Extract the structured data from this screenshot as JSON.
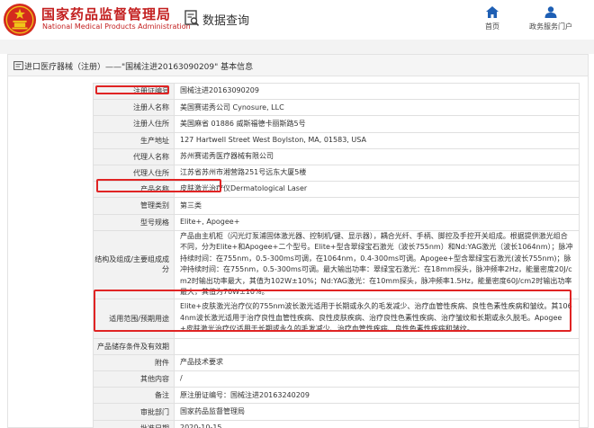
{
  "header": {
    "org_name_cn": "国家药品监督管理局",
    "org_name_en": "National Medical Products Administration",
    "query_label": "数据查询",
    "nav_home_label": "首页",
    "nav_portal_label": "政务服务门户"
  },
  "breadcrumb": {
    "text": "进口医疗器械（注册）——\"国械注进20163090209\" 基本信息"
  },
  "details": [
    {
      "label": "注册证编号",
      "value": "国械注进20163090209"
    },
    {
      "label": "注册人名称",
      "value": "美国赛诺秀公司 Cynosure, LLC"
    },
    {
      "label": "注册人住所",
      "value": "美国麻省 01886 威斯福德卡丽斯路5号"
    },
    {
      "label": "生产地址",
      "value": "127 Hartwell Street West Boylston, MA, 01583, USA"
    },
    {
      "label": "代理人名称",
      "value": "苏州赛诺秀医疗器械有限公司"
    },
    {
      "label": "代理人住所",
      "value": "江苏省苏州市湘营路251号远东大厦5楼"
    },
    {
      "label": "产品名称",
      "value": "皮肤激光治疗仪Dermatological Laser"
    },
    {
      "label": "管理类别",
      "value": "第三类"
    },
    {
      "label": "型号规格",
      "value": "Elite+, Apogee+"
    },
    {
      "label": "结构及组成/主要组成成分",
      "value": "产品由主机柜（闪光灯泵浦固体激光器、控制机/键、显示器），耦合光纤、手柄、脚控及手控开关组成。根据提供激光组合不同，分为Elite+和Apogee+二个型号。Elite+型含翠绿宝石激光（波长755nm）和Nd:YAG激光（波长1064nm）；脉冲持续时间：在755nm，0.5-300ms可调，在1064nm，0.4-300ms可调。Apogee+型含翠绿宝石激光(波长755nm)；脉冲持续时间：在755nm，0.5-300ms可调。最大输出功率：翠绿宝石激光：在18mm探头，脉冲频率2Hz，能量密度20J/cm2时输出功率最大，其值为102W±10%；Nd:YAG激光：在10mm探头，脉冲频率1.5Hz，能量密度60J/cm2时输出功率最大，其值为70W±10%。"
    },
    {
      "label": "适用范围/预期用途",
      "value": "Elite+皮肤激光治疗仪的755nm波长激光适用于长期或永久的毛发减少、治疗血管性疾病、良性色素性疾病和皱纹。其1064nm波长激光适用于治疗良性血管性疾病、良性皮肤疾病、治疗良性色素性疾病、治疗皱纹和长期或永久脱毛。Apogee+皮肤激光治疗仪适用于长期或永久的毛发减少、治疗血管性疾病、良性色素性疾病和皱纹。"
    },
    {
      "label": "产品储存条件及有效期",
      "value": ""
    },
    {
      "label": "附件",
      "value": "产品技术要求"
    },
    {
      "label": "其他内容",
      "value": "/"
    },
    {
      "label": "备注",
      "value": "原注册证编号：国械注进20163240209"
    },
    {
      "label": "审批部门",
      "value": "国家药品监督管理局"
    },
    {
      "label": "批准日期",
      "value": "2020-10-15"
    }
  ]
}
